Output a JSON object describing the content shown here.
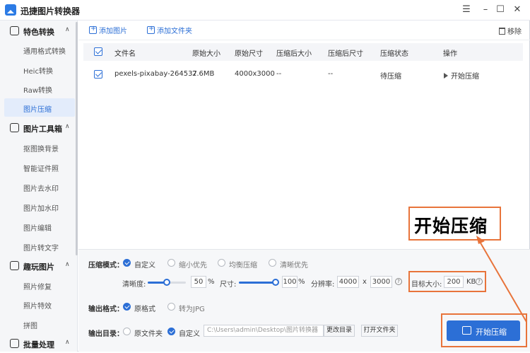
{
  "window": {
    "title": "迅捷图片转换器"
  },
  "sidebar": {
    "groups": [
      {
        "label": "特色转换",
        "items": [
          "通用格式转换",
          "Heic转换",
          "Raw转换",
          "图片压缩"
        ]
      },
      {
        "label": "图片工具箱",
        "items": [
          "抠图换背景",
          "智能证件照",
          "图片去水印",
          "图片加水印",
          "图片编辑",
          "图片转文字"
        ]
      },
      {
        "label": "趣玩图片",
        "items": [
          "照片修复",
          "照片特效",
          "拼图"
        ]
      },
      {
        "label": "批量处理",
        "items": []
      }
    ],
    "active_item": "图片压缩"
  },
  "toolbar": {
    "add_image": "添加图片",
    "add_folder": "添加文件夹",
    "remove": "移除"
  },
  "table": {
    "headers": [
      "文件名",
      "原始大小",
      "原始尺寸",
      "压缩后大小",
      "压缩后尺寸",
      "压缩状态",
      "操作"
    ],
    "rows": [
      {
        "name": "pexels-pixabay-264537",
        "size": "2.6MB",
        "dims": "4000x3000",
        "new_size": "--",
        "new_dims": "--",
        "status": "待压缩",
        "action": "开始压缩"
      }
    ]
  },
  "settings": {
    "mode_label": "压缩模式：",
    "modes": [
      "自定义",
      "缩小优先",
      "均衡压缩",
      "清晰优先"
    ],
    "selected_mode": "自定义",
    "clarity_label": "清晰度:",
    "clarity_value": "50",
    "clarity_unit": "%",
    "clarity_level": 0.5,
    "size_label": "尺寸:",
    "size_value": "100",
    "size_unit": "%",
    "size_level": 1.0,
    "resolution_label": "分辨率:",
    "res_w": "4000",
    "res_x": "x",
    "res_h": "3000",
    "target_label": "目标大小:",
    "target_value": "200",
    "target_unit": "KB",
    "format_label": "输出格式：",
    "formats": [
      "原格式",
      "转为JPG"
    ],
    "dir_label": "输出目录：",
    "dirs": [
      "原文件夹",
      "自定义"
    ],
    "dir_path": "C:\\Users\\admin\\Desktop\\图片转换器",
    "change_dir": "更改目录",
    "open_folder": "打开文件夹",
    "start_button": "开始压缩"
  },
  "annotation": {
    "callout_text": "开始压缩",
    "color": "#e8743b"
  }
}
